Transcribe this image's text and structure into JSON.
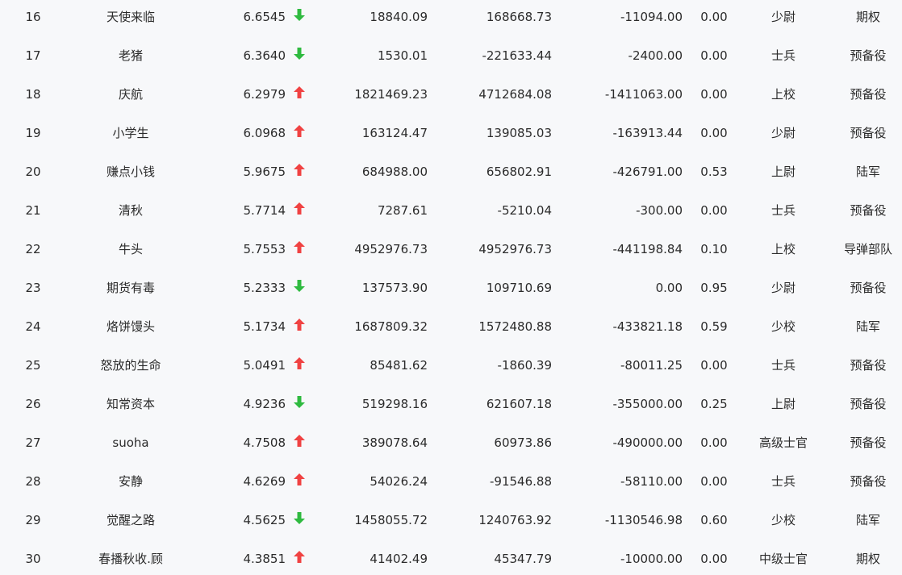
{
  "colors": {
    "up_arrow": "#f04242",
    "down_arrow": "#2fba40",
    "background": "#f7f8fa",
    "text": "#2b2b2b"
  },
  "rows": [
    {
      "rank": "16",
      "name": "天使来临",
      "score": "6.6545",
      "trend": "down",
      "value1": "18840.09",
      "value2": "168668.73",
      "value3": "-11094.00",
      "ratio": "0.00",
      "military_rank": "少尉",
      "unit": "期权"
    },
    {
      "rank": "17",
      "name": "老猪",
      "score": "6.3640",
      "trend": "down",
      "value1": "1530.01",
      "value2": "-221633.44",
      "value3": "-2400.00",
      "ratio": "0.00",
      "military_rank": "士兵",
      "unit": "预备役"
    },
    {
      "rank": "18",
      "name": "庆航",
      "score": "6.2979",
      "trend": "up",
      "value1": "1821469.23",
      "value2": "4712684.08",
      "value3": "-1411063.00",
      "ratio": "0.00",
      "military_rank": "上校",
      "unit": "预备役"
    },
    {
      "rank": "19",
      "name": "小学生",
      "score": "6.0968",
      "trend": "up",
      "value1": "163124.47",
      "value2": "139085.03",
      "value3": "-163913.44",
      "ratio": "0.00",
      "military_rank": "少尉",
      "unit": "预备役"
    },
    {
      "rank": "20",
      "name": "赚点小钱",
      "score": "5.9675",
      "trend": "up",
      "value1": "684988.00",
      "value2": "656802.91",
      "value3": "-426791.00",
      "ratio": "0.53",
      "military_rank": "上尉",
      "unit": "陆军"
    },
    {
      "rank": "21",
      "name": "清秋",
      "score": "5.7714",
      "trend": "up",
      "value1": "7287.61",
      "value2": "-5210.04",
      "value3": "-300.00",
      "ratio": "0.00",
      "military_rank": "士兵",
      "unit": "预备役"
    },
    {
      "rank": "22",
      "name": "牛头",
      "score": "5.7553",
      "trend": "up",
      "value1": "4952976.73",
      "value2": "4952976.73",
      "value3": "-441198.84",
      "ratio": "0.10",
      "military_rank": "上校",
      "unit": "导弹部队"
    },
    {
      "rank": "23",
      "name": "期货有毒",
      "score": "5.2333",
      "trend": "down",
      "value1": "137573.90",
      "value2": "109710.69",
      "value3": "0.00",
      "ratio": "0.95",
      "military_rank": "少尉",
      "unit": "预备役"
    },
    {
      "rank": "24",
      "name": "烙饼馒头",
      "score": "5.1734",
      "trend": "up",
      "value1": "1687809.32",
      "value2": "1572480.88",
      "value3": "-433821.18",
      "ratio": "0.59",
      "military_rank": "少校",
      "unit": "陆军"
    },
    {
      "rank": "25",
      "name": "怒放的生命",
      "score": "5.0491",
      "trend": "up",
      "value1": "85481.62",
      "value2": "-1860.39",
      "value3": "-80011.25",
      "ratio": "0.00",
      "military_rank": "士兵",
      "unit": "预备役"
    },
    {
      "rank": "26",
      "name": "知常资本",
      "score": "4.9236",
      "trend": "down",
      "value1": "519298.16",
      "value2": "621607.18",
      "value3": "-355000.00",
      "ratio": "0.25",
      "military_rank": "上尉",
      "unit": "预备役"
    },
    {
      "rank": "27",
      "name": "suoha",
      "score": "4.7508",
      "trend": "up",
      "value1": "389078.64",
      "value2": "60973.86",
      "value3": "-490000.00",
      "ratio": "0.00",
      "military_rank": "高级士官",
      "unit": "预备役"
    },
    {
      "rank": "28",
      "name": "安静",
      "score": "4.6269",
      "trend": "up",
      "value1": "54026.24",
      "value2": "-91546.88",
      "value3": "-58110.00",
      "ratio": "0.00",
      "military_rank": "士兵",
      "unit": "预备役"
    },
    {
      "rank": "29",
      "name": "觉醒之路",
      "score": "4.5625",
      "trend": "down",
      "value1": "1458055.72",
      "value2": "1240763.92",
      "value3": "-1130546.98",
      "ratio": "0.60",
      "military_rank": "少校",
      "unit": "陆军"
    },
    {
      "rank": "30",
      "name": "春播秋收.顾",
      "score": "4.3851",
      "trend": "up",
      "value1": "41402.49",
      "value2": "45347.79",
      "value3": "-10000.00",
      "ratio": "0.00",
      "military_rank": "中级士官",
      "unit": "期权"
    }
  ]
}
